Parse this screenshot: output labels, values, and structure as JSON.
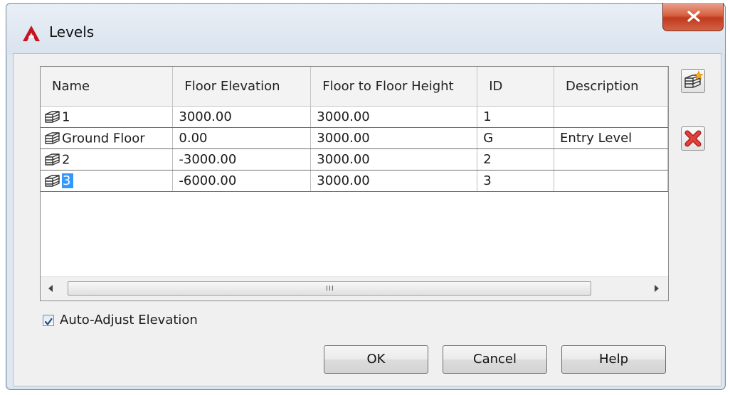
{
  "window": {
    "title": "Levels"
  },
  "columns": [
    "Name",
    "Floor Elevation",
    "Floor to Floor Height",
    "ID",
    "Description"
  ],
  "rows": [
    {
      "name": "1",
      "floor_elevation": "3000.00",
      "floor_to_floor_height": "3000.00",
      "id": "1",
      "description": ""
    },
    {
      "name": "Ground Floor",
      "floor_elevation": "0.00",
      "floor_to_floor_height": "3000.00",
      "id": "G",
      "description": "Entry Level"
    },
    {
      "name": "2",
      "floor_elevation": "-3000.00",
      "floor_to_floor_height": "3000.00",
      "id": "2",
      "description": ""
    },
    {
      "name": "3",
      "floor_elevation": "-6000.00",
      "floor_to_floor_height": "3000.00",
      "id": "3",
      "description": ""
    }
  ],
  "scrollbar": {
    "grip": "III"
  },
  "options": {
    "auto_adjust_label": "Auto-Adjust Elevation",
    "auto_adjust_checked": true
  },
  "buttons": {
    "ok": "OK",
    "cancel": "Cancel",
    "help": "Help"
  },
  "icons": {
    "app": "autocad-a-icon",
    "close": "close-x-icon",
    "add_level": "add-level-icon",
    "delete_level": "delete-red-x-icon",
    "level_row": "level-stack-icon"
  },
  "colors": {
    "close_button": "#c9462a",
    "selection": "#3399ff",
    "delete_icon": "#d8322f"
  }
}
